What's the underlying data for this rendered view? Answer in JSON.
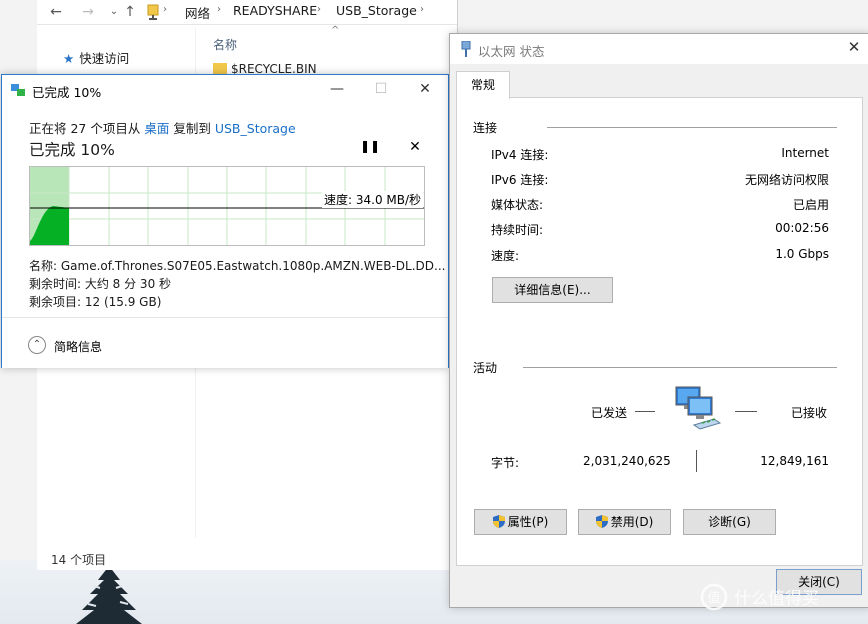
{
  "explorer": {
    "breadcrumb": [
      "网络",
      "READYSHARE",
      "USB_Storage"
    ],
    "nav": {
      "quick_access": "快速访问"
    },
    "column_name": "名称",
    "first_item": "$RECYCLE.BIN",
    "status_count": "14 个项目"
  },
  "copy_dialog": {
    "title": "已完成 10%",
    "desc_prefix": "正在将 27 个项目从",
    "source": "桌面",
    "desc_mid": "复制到",
    "destination": "USB_Storage",
    "percent_label": "已完成 10%",
    "progress": 0.1,
    "speed_label": "速度: 34.0 MB/秒",
    "name_line": "名称: Game.of.Thrones.S07E05.Eastwatch.1080p.AMZN.WEB-DL.DD...",
    "remaining_time": "剩余时间: 大约 8 分 30 秒",
    "remaining_items": "剩余项目: 12 (15.9 GB)",
    "details_toggle": "简略信息",
    "colors": {
      "fill": "#06b025",
      "fill_light": "#b8e6b8",
      "grid": "#c7e8c7"
    }
  },
  "ethernet_dialog": {
    "title": "以太网 状态",
    "tab": "常规",
    "connection": {
      "section": "连接",
      "rows": [
        {
          "label": "IPv4 连接:",
          "value": "Internet"
        },
        {
          "label": "IPv6 连接:",
          "value": "无网络访问权限"
        },
        {
          "label": "媒体状态:",
          "value": "已启用"
        },
        {
          "label": "持续时间:",
          "value": "00:02:56"
        },
        {
          "label": "速度:",
          "value": "1.0 Gbps"
        }
      ],
      "details_button": "详细信息(E)..."
    },
    "activity": {
      "section": "活动",
      "sent_label": "已发送",
      "received_label": "已接收",
      "bytes_label": "字节:",
      "bytes_sent": "2,031,240,625",
      "bytes_received": "12,849,161"
    },
    "buttons": {
      "properties": "属性(P)",
      "disable": "禁用(D)",
      "diagnose": "诊断(G)",
      "close": "关闭(C)"
    }
  }
}
